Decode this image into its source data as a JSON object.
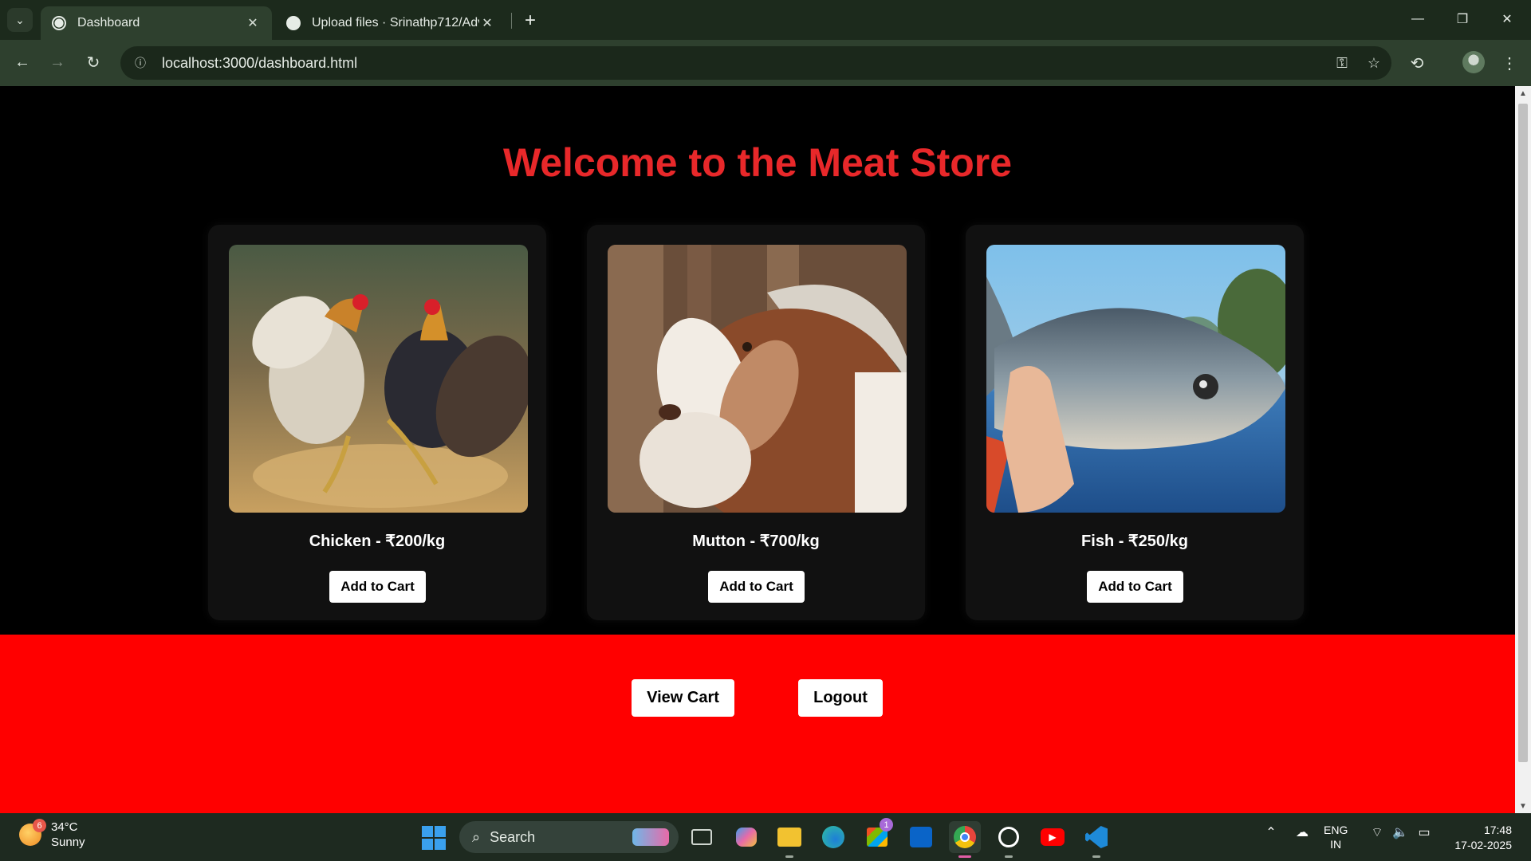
{
  "browser": {
    "tabs": [
      {
        "title": "Dashboard",
        "active": true
      },
      {
        "title": "Upload files · Srinathp712/Adva",
        "active": false
      }
    ],
    "url": "localhost:3000/dashboard.html"
  },
  "page": {
    "heading": "Welcome to the Meat Store",
    "products": [
      {
        "name": "Chicken - ₹200/kg",
        "button": "Add to Cart",
        "image": "rooster-photo"
      },
      {
        "name": "Mutton - ₹700/kg",
        "button": "Add to Cart",
        "image": "goat-photo"
      },
      {
        "name": "Fish - ₹250/kg",
        "button": "Add to Cart",
        "image": "fish-photo"
      }
    ],
    "footer": {
      "view_cart": "View Cart",
      "logout": "Logout"
    },
    "colors": {
      "heading": "#e8282a",
      "footer_bg": "#ff0000",
      "card_bg": "#111111"
    }
  },
  "taskbar": {
    "weather": {
      "temp": "34°C",
      "condition": "Sunny",
      "badge": "6"
    },
    "search_placeholder": "Search",
    "store_badge": "1",
    "lang_line1": "ENG",
    "lang_line2": "IN",
    "time": "17:48",
    "date": "17-02-2025"
  }
}
